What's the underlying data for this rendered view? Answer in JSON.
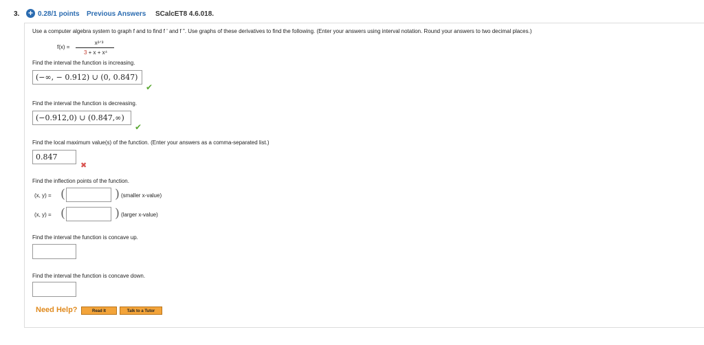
{
  "header": {
    "question_number": "3.",
    "points": "0.28/1 points",
    "previous_answers": "Previous Answers",
    "code": "SCalcET8 4.6.018."
  },
  "instructions": "Use a computer algebra system to graph f and to find f ' and f \". Use graphs of these derivatives to find the following. (Enter your answers using interval notation. Round your answers to two decimal places.)",
  "function": {
    "label": "f(x) =",
    "numerator": "x²ᐟ³",
    "denominator_red": "3",
    "denominator_rest": " + x + x⁴"
  },
  "parts": {
    "increasing": {
      "prompt": "Find the interval the function is increasing.",
      "answer": "(−∞, − 0.912) ∪ (0, 0.847)",
      "status": "correct"
    },
    "decreasing": {
      "prompt": "Find the interval the function is decreasing.",
      "answer": "(−0.912,0) ∪ (0.847,∞)",
      "status": "correct"
    },
    "local_max": {
      "prompt": "Find the local maximum value(s) of the function. (Enter your answers as a comma-separated list.)",
      "answer": "0.847",
      "status": "incorrect"
    },
    "inflection": {
      "prompt": "Find the inflection points of the function.",
      "row1_label": "(x, y) =",
      "row1_note": "(smaller x-value)",
      "row2_label": "(x, y) =",
      "row2_note": "(larger x-value)"
    },
    "concave_up": {
      "prompt": "Find the interval the function is concave up."
    },
    "concave_down": {
      "prompt": "Find the interval the function is concave down."
    }
  },
  "help": {
    "label": "Need Help?",
    "read_it": "Read It",
    "talk_to_tutor": "Talk to a Tutor"
  },
  "icons": {
    "points": "plus-circle-icon",
    "correct": "check-icon",
    "incorrect": "cross-icon"
  },
  "colors": {
    "link": "#2a6bb0",
    "correct": "#5aa832",
    "incorrect": "#d9534f",
    "help": "#e08a1e",
    "button": "#f3a43a"
  }
}
